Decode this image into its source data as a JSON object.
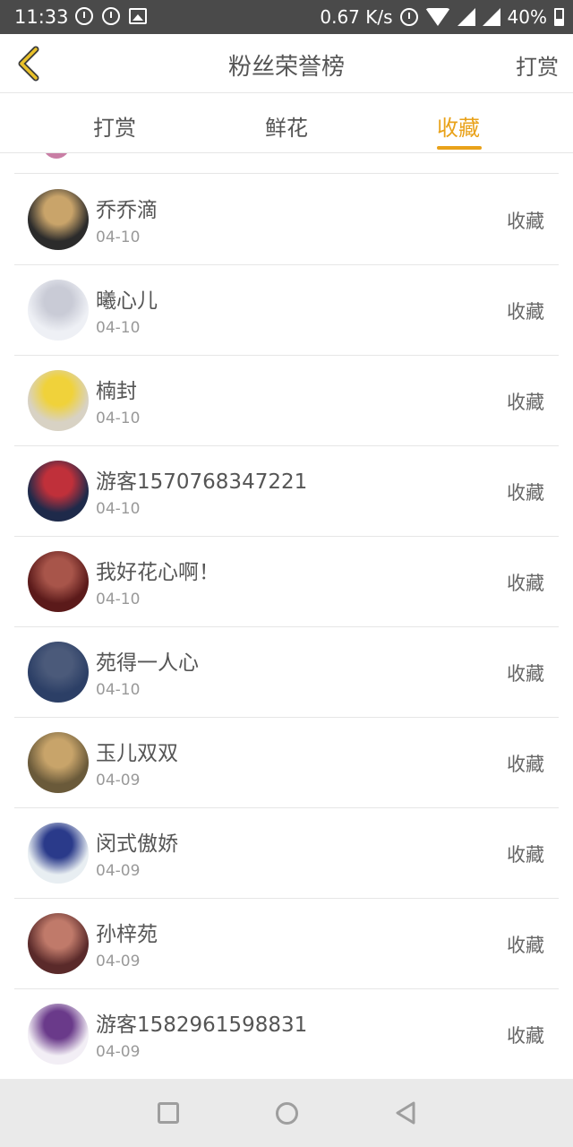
{
  "status_bar": {
    "time": "11:33",
    "speed": "0.67 K/s",
    "battery": "40%",
    "icons": [
      "alarm-icon",
      "alarm-icon",
      "image-icon",
      "alarm-icon",
      "wifi-icon",
      "signal-icon",
      "signal-icon",
      "battery-icon"
    ]
  },
  "header": {
    "title": "粉丝荣誉榜",
    "right_action": "打赏",
    "back_icon": "chevron-left-icon"
  },
  "tabs": [
    {
      "label": "打赏",
      "active": false
    },
    {
      "label": "鲜花",
      "active": false
    },
    {
      "label": "收藏",
      "active": true
    }
  ],
  "colors": {
    "accent": "#e9a21a",
    "text": "#555555",
    "subtext": "#999999",
    "divider": "#e6e6e6",
    "status_bar": "#4a4a4a",
    "nav_bar": "#eaeaea"
  },
  "list": [
    {
      "name": "乔乔滴",
      "date": "04-10",
      "action": "收藏",
      "avatar_colors": [
        "#2b2b2b",
        "#c9a46a"
      ]
    },
    {
      "name": "曦心儿",
      "date": "04-10",
      "action": "收藏",
      "avatar_colors": [
        "#eef0f5",
        "#c9cbd6"
      ]
    },
    {
      "name": "楠封",
      "date": "04-10",
      "action": "收藏",
      "avatar_colors": [
        "#d8d2c4",
        "#f0d23a"
      ]
    },
    {
      "name": "游客1570768347221",
      "date": "04-10",
      "action": "收藏",
      "avatar_colors": [
        "#1e2a4a",
        "#c0303a"
      ]
    },
    {
      "name": "我好花心啊！",
      "date": "04-10",
      "action": "收藏",
      "avatar_colors": [
        "#5b1a1a",
        "#a8554a"
      ]
    },
    {
      "name": "苑得一人心",
      "date": "04-10",
      "action": "收藏",
      "avatar_colors": [
        "#2c3f66",
        "#4b5a7a"
      ]
    },
    {
      "name": "玉儿双双",
      "date": "04-09",
      "action": "收藏",
      "avatar_colors": [
        "#6a5a3a",
        "#c8a46a"
      ]
    },
    {
      "name": "闵式傲娇",
      "date": "04-09",
      "action": "收藏",
      "avatar_colors": [
        "#e8eef2",
        "#2a3a8a"
      ]
    },
    {
      "name": "孙梓苑",
      "date": "04-09",
      "action": "收藏",
      "avatar_colors": [
        "#5a2a2a",
        "#c07a6a"
      ]
    },
    {
      "name": "游客1582961598831",
      "date": "04-09",
      "action": "收藏",
      "avatar_colors": [
        "#f2eef5",
        "#6a3a8a"
      ]
    }
  ],
  "nav_bar": {
    "icons": [
      "recent-apps-icon",
      "home-icon",
      "back-icon"
    ]
  }
}
